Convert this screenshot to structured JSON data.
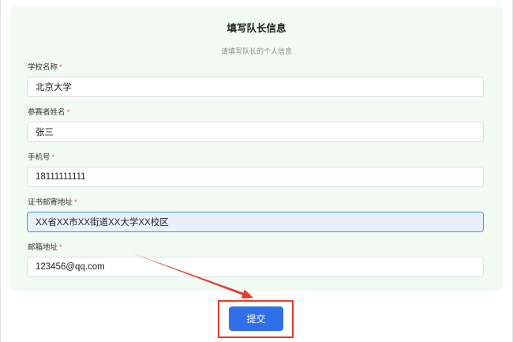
{
  "form": {
    "title": "填写队长信息",
    "subtitle": "请填写队长的个人信息",
    "required_mark": "*",
    "fields": [
      {
        "label": "学校名称",
        "value": "北京大学"
      },
      {
        "label": "参赛者姓名",
        "value": "张三"
      },
      {
        "label": "手机号",
        "value": "18111111111"
      },
      {
        "label": "证书邮寄地址",
        "value": "XX省XX市XX街道XX大学XX校区"
      },
      {
        "label": "邮箱地址",
        "value": "123456@qq.com"
      }
    ],
    "submit_label": "提交"
  },
  "colors": {
    "card_bg": "#f1fbf1",
    "accent": "#2f6fe9",
    "required": "#f04b4b",
    "focus_border": "#4a8ff0",
    "focus_bg": "#e8f0fe",
    "annotation": "#e8392c"
  }
}
